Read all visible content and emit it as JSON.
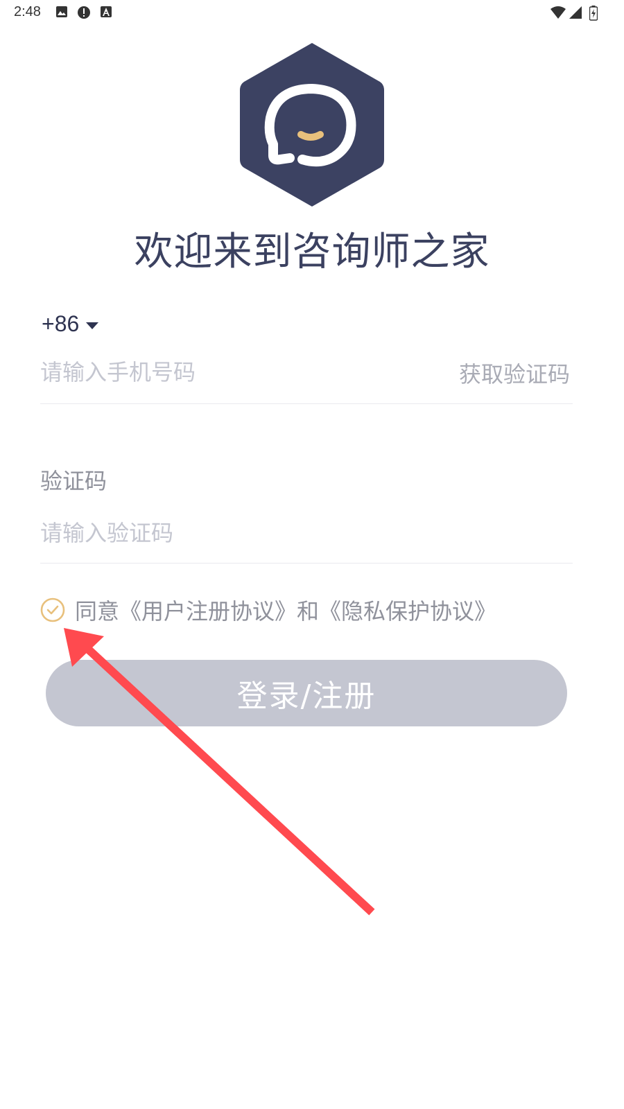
{
  "status_bar": {
    "time": "2:48",
    "left_icons": [
      "image-icon",
      "alert-icon",
      "font-icon"
    ],
    "right_icons": [
      "wifi-icon",
      "signal-icon",
      "battery-icon"
    ]
  },
  "logo": {
    "icon": "chat-bubble-hexagon-logo",
    "hex_color": "#3c4262",
    "accent_color": "#e8c07c"
  },
  "welcome": {
    "title": "欢迎来到咨询师之家"
  },
  "phone": {
    "country_code": "+86",
    "placeholder": "请输入手机号码",
    "value": "",
    "get_code_label": "获取验证码"
  },
  "verification": {
    "label": "验证码",
    "placeholder": "请输入验证码",
    "value": ""
  },
  "agreement": {
    "text": "同意《用户注册协议》和《隐私保护协议》",
    "check_color": "#e8c07c"
  },
  "login": {
    "label": "登录/注册",
    "color": "#c4c6d1"
  },
  "annotation": {
    "icon": "red-arrow-icon",
    "color": "#ff4a4f"
  }
}
